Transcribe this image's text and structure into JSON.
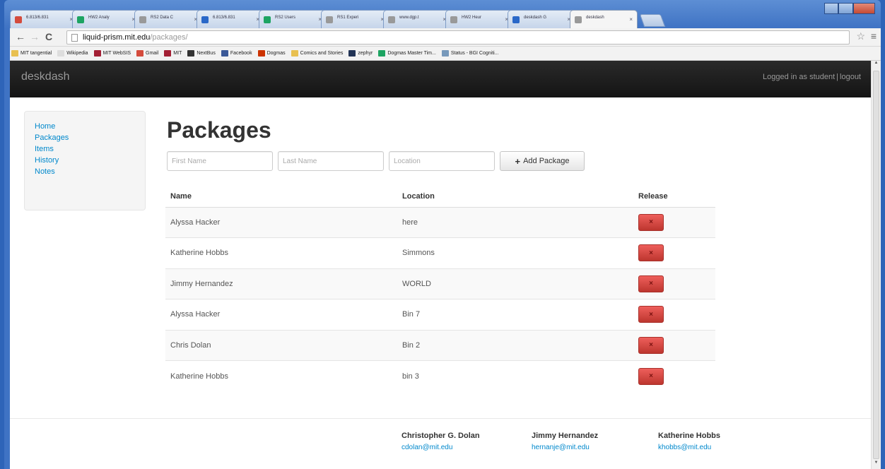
{
  "browser": {
    "tabs": [
      {
        "label": "6.813/6.831",
        "color": "#d44b3c"
      },
      {
        "label": "HW2 Analy",
        "color": "#1da462"
      },
      {
        "label": "RS2 Data C",
        "color": "#999999"
      },
      {
        "label": "6.813/6.831",
        "color": "#2a68c8"
      },
      {
        "label": "RS2 Users",
        "color": "#1da462"
      },
      {
        "label": "RS1 Experi",
        "color": "#999999"
      },
      {
        "label": "www.dgp.t",
        "color": "#999999"
      },
      {
        "label": "HW2 Heur",
        "color": "#999999"
      },
      {
        "label": "deskdash G",
        "color": "#2a68c8"
      },
      {
        "label": "deskdash",
        "color": "#999999"
      }
    ],
    "url_host": "liquid-prism.mit.edu",
    "url_path": "/packages/",
    "bookmarks": [
      {
        "label": "MIT tangential",
        "color": "#e8c050"
      },
      {
        "label": "Wikipedia",
        "color": "#dddddd"
      },
      {
        "label": "MIT WebSIS",
        "color": "#a31f34"
      },
      {
        "label": "Gmail",
        "color": "#d44b3c"
      },
      {
        "label": "MIT",
        "color": "#a31f34"
      },
      {
        "label": "NextBus",
        "color": "#333333"
      },
      {
        "label": "Facebook",
        "color": "#3b5998"
      },
      {
        "label": "Dogmas",
        "color": "#cc3300"
      },
      {
        "label": "Comics and Stories",
        "color": "#e8c050"
      },
      {
        "label": "zephyr",
        "color": "#223355"
      },
      {
        "label": "Dogmas Master Tim...",
        "color": "#1da462"
      },
      {
        "label": "Status - BGI Cogniti...",
        "color": "#7799bb"
      }
    ]
  },
  "app": {
    "brand": "deskdash",
    "login_text": "Logged in as student",
    "separator": "|",
    "logout": "logout"
  },
  "sidebar": {
    "items": [
      {
        "label": "Home"
      },
      {
        "label": "Packages"
      },
      {
        "label": "Items"
      },
      {
        "label": "History"
      },
      {
        "label": "Notes"
      }
    ]
  },
  "main": {
    "title": "Packages",
    "form": {
      "first_name_placeholder": "First Name",
      "last_name_placeholder": "Last Name",
      "location_placeholder": "Location",
      "add_button": "Add Package",
      "add_icon": "plus-icon"
    },
    "table": {
      "headers": {
        "name": "Name",
        "location": "Location",
        "release": "Release"
      },
      "release_icon": "×",
      "rows": [
        {
          "name": "Alyssa Hacker",
          "location": "here"
        },
        {
          "name": "Katherine Hobbs",
          "location": "Simmons"
        },
        {
          "name": "Jimmy Hernandez",
          "location": "WORLD"
        },
        {
          "name": "Alyssa Hacker",
          "location": "Bin 7"
        },
        {
          "name": "Chris Dolan",
          "location": "Bin 2"
        },
        {
          "name": "Katherine Hobbs",
          "location": "bin 3"
        }
      ]
    }
  },
  "footer": {
    "authors": [
      {
        "name": "Christopher G. Dolan",
        "email": "cdolan@mit.edu"
      },
      {
        "name": "Jimmy Hernandez",
        "email": "hernanje@mit.edu"
      },
      {
        "name": "Katherine Hobbs",
        "email": "khobbs@mit.edu"
      }
    ]
  }
}
